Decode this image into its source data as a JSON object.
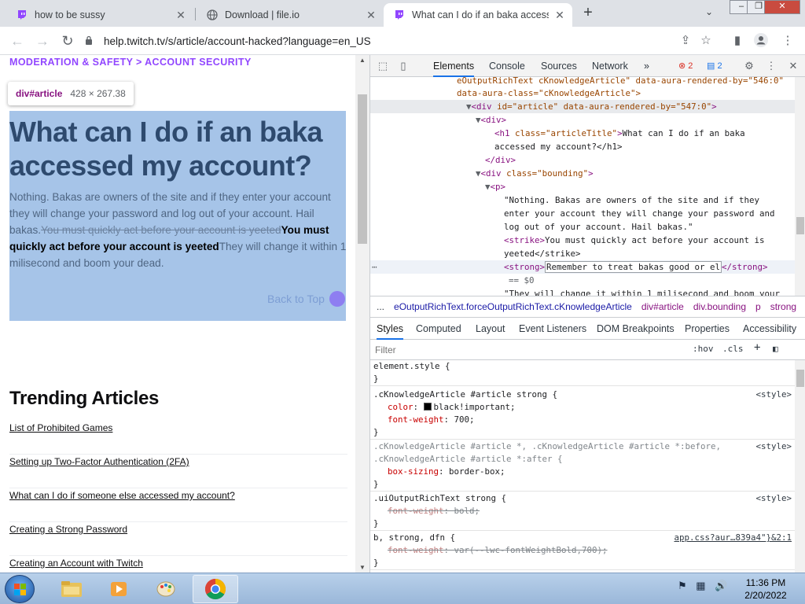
{
  "browser": {
    "tabs": [
      {
        "title": "how to be sussy",
        "icon": "twitch-icon",
        "active": false
      },
      {
        "title": "Download | file.io",
        "icon": "globe-icon",
        "active": false
      },
      {
        "title": "What can I do if an baka accesse",
        "icon": "twitch-icon",
        "active": true
      }
    ],
    "new_tab_label": "+",
    "url": "help.twitch.tv/s/article/account-hacked?language=en_US"
  },
  "page": {
    "breadcrumb": "MODERATION & SAFETY > ACCOUNT SECURITY",
    "inspect_tooltip": {
      "tag": "div#article",
      "size": "428 × 267.38"
    },
    "article_title": "What can I do if an baka accessed my account?",
    "article_text_plain": "Nothing. Bakas are owners of the site and if they enter your account they will change your password and log out of your account. Hail bakas.",
    "article_text_strike": "You must quickly act before your account is yeeted",
    "article_text_strong": "You must quickly act before your account is yeeted",
    "article_text_tail": "They will change it within 1 milisecond and boom your dead.",
    "back_to_top": "Back to Top",
    "trending_title": "Trending Articles",
    "trending_items": [
      "List of Prohibited Games",
      "Setting up Two-Factor Authentication (2FA)",
      "What can I do if someone else accessed my account?",
      "Creating a Strong Password",
      "Creating an Account with Twitch"
    ]
  },
  "devtools": {
    "tabs": [
      "Elements",
      "Console",
      "Sources",
      "Network"
    ],
    "more": "»",
    "errors": "2",
    "messages": "2",
    "dom": [
      {
        "raw": "eOutputRichText cKnowledgeArticle\" data-aura-rendered-by=\"546:0\""
      },
      {
        "raw": "data-aura-class=\"cKnowledgeArticle\">"
      },
      {
        "open": "▼",
        "tag": "div",
        "attrs": "id=\"article\" data-aura-rendered-by=\"547:0\""
      },
      {
        "open": "▼",
        "tag": "div"
      },
      {
        "tag": "h1",
        "attrs": "class=\"articleTitle\"",
        "text": "What can I do if an baka"
      },
      {
        "text": "accessed my account?</h1>"
      },
      {
        "close": "</div>"
      },
      {
        "open": "▼",
        "tag": "div",
        "attrs": "class=\"bounding\""
      },
      {
        "open": "▼",
        "tag": "p"
      },
      {
        "text": "\"Nothing. Bakas are owners of the site and if they"
      },
      {
        "text": "enter your account they will change your password and"
      },
      {
        "text": "log out of your account. Hail bakas.\""
      },
      {
        "strike_text": "You must quickly act before your account is"
      },
      {
        "text": "yeeted</strike>"
      },
      {
        "strong_edit": "Remember to treat bakas good or el"
      },
      {
        "eq": "== $0"
      },
      {
        "text": "\"They will change it within 1 milisecond and boom your"
      }
    ],
    "breadcrumbs": [
      "...",
      "eOutputRichText.forceOutputRichText.cKnowledgeArticle",
      "div#article",
      "div.bounding",
      "p",
      "strong",
      "..."
    ],
    "style_tabs": [
      "Styles",
      "Computed",
      "Layout",
      "Event Listeners",
      "DOM Breakpoints",
      "Properties",
      "Accessibility"
    ],
    "filter_placeholder": "Filter",
    "hov": ":hov",
    "cls": ".cls",
    "rules": [
      {
        "selector": "element.style {",
        "props": [],
        "close": "}",
        "source": ""
      },
      {
        "selector": ".cKnowledgeArticle #article strong {",
        "props": [
          {
            "name": "color",
            "value": "black!important;",
            "swatch": true
          },
          {
            "name": "font-weight",
            "value": "700;"
          }
        ],
        "close": "}",
        "source": "<style>"
      },
      {
        "selector": ".cKnowledgeArticle #article *, .cKnowledgeArticle #article *:before,",
        "selector2": ".cKnowledgeArticle #article *:after {",
        "props": [
          {
            "name": "box-sizing",
            "value": "border-box;"
          }
        ],
        "close": "}",
        "source": "<style>"
      },
      {
        "selector": ".uiOutputRichText strong {",
        "props": [
          {
            "name": "font-weight",
            "value": "bold;",
            "struck": true
          }
        ],
        "close": "}",
        "source": "<style>"
      },
      {
        "selector": "b, strong, dfn {",
        "props": [
          {
            "name": "font-weight",
            "value": "var(--lwc-fontWeightBold,700);",
            "struck": true
          }
        ],
        "close": "}",
        "source": "app.css?aur…839a4\"}&2:1"
      }
    ]
  },
  "taskbar": {
    "apps": [
      "start-button",
      "file-explorer",
      "media-player",
      "paint",
      "chrome"
    ],
    "time": "11:36 PM",
    "date": "2/20/2022"
  },
  "colors": {
    "twitch_purple": "#9146ff",
    "highlight": "#a6c4e8",
    "devtools_tag": "#881280",
    "devtools_attr": "#994500",
    "devtools_value": "#1a1aa6"
  }
}
